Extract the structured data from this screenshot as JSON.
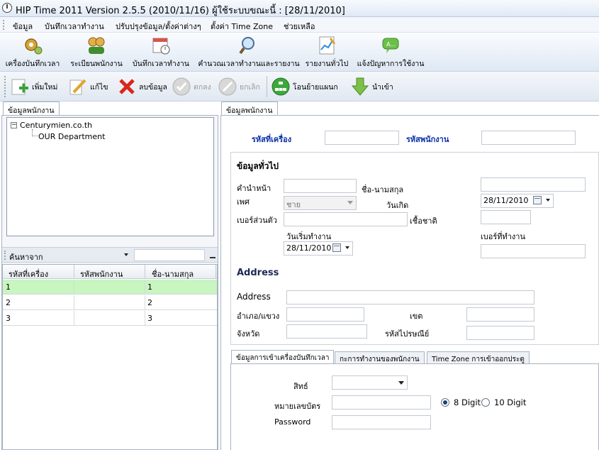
{
  "window": {
    "title": "HIP Time 2011 Version 2.5.5 (2010/11/16)   ผู้ใช้ระบบขณะนี้  :  [28/11/2010]"
  },
  "menu": {
    "items": [
      "ข้อมูล",
      "บันทึกเวลาทำงาน",
      "ปรับปรุงข้อมูล/ตั้งค่าต่างๆ",
      "ตั้งค่า Time Zone",
      "ช่วยเหลือ"
    ]
  },
  "ribbon": {
    "buttons": [
      "เครื่องบันทึกเวลา",
      "ระเบียนพนักงาน",
      "บันทึกเวลาทำงาน",
      "คำนวณเวลาทำงานและรายงาน",
      "รายงานทั่วไป",
      "แจ้งปัญหาการใช้งาน"
    ]
  },
  "toolbar": {
    "add": "เพิ่มใหม่",
    "edit": "แก้ไข",
    "delete": "ลบข้อมูล",
    "ok": "ตกลง",
    "cancel": "ยกเลิก",
    "move": "โอนย้ายแผนก",
    "import": "นำเข้า"
  },
  "left": {
    "tab": "ข้อมูลพนักงาน",
    "tree": {
      "root": "Centurymien.co.th",
      "child": "OUR Department"
    },
    "search": {
      "label": "ค้นหาจาก",
      "value": ""
    },
    "columns": [
      "รหัสที่เครื่อง",
      "รหัสพนักงาน",
      "ชื่อ-นามสกุล"
    ],
    "rows": [
      {
        "machine": "1",
        "emp": "",
        "name": "1"
      },
      {
        "machine": "2",
        "emp": "",
        "name": "2"
      },
      {
        "machine": "3",
        "emp": "",
        "name": "3"
      }
    ]
  },
  "right": {
    "tab": "ข้อมูลพนักงาน",
    "machine_code_label": "รหัสที่เครื่อง",
    "emp_code_label": "รหัสพนักงาน",
    "general_title": "ข้อมูลทั่วไป",
    "prefix_label": "คำนำหน้า",
    "fullname_label": "ชื่อ-นามสกุล",
    "gender_label": "เพศ",
    "gender_value": "ชาย",
    "birthdate_label": "วันเกิด",
    "birthdate_value": "28/11/2010",
    "personal_phone_label": "เบอร์ส่วนตัว",
    "nationality_label": "เชื้อชาติ",
    "start_date_label": "วันเริ่มทำงาน",
    "start_date_value": "28/11/2010",
    "work_phone_label": "เบอร์ที่ทำงาน",
    "address_title": "Address",
    "address_label": "Address",
    "district_label": "อำเภอ/แขวง",
    "zone_label": "เขต",
    "province_label": "จังหวัด",
    "postcode_label": "รหัสไปรษณีย์",
    "subtabs": [
      "ข้อมูลการเข้าเครื่องบันทึกเวลา",
      "กะการทำงานของพนักงาน",
      "Time Zone การเข้าออกประตู"
    ],
    "rights_label": "สิทธ์",
    "card_label": "หมายเลขบัตร",
    "digit8": "8 Digit",
    "digit10": "10 Digit",
    "password_label": "Password"
  }
}
